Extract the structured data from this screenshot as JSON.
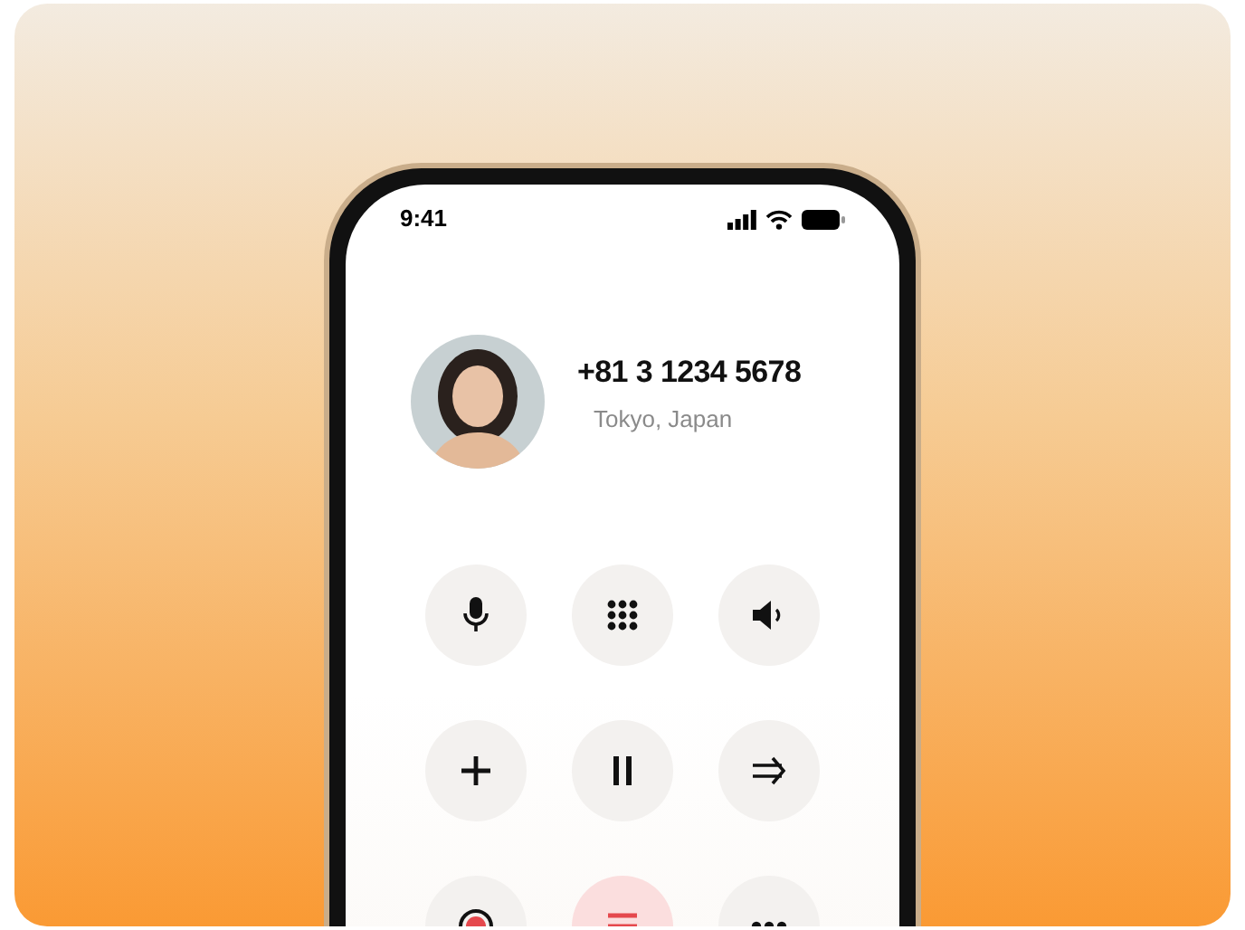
{
  "status_bar": {
    "time": "9:41"
  },
  "contact": {
    "number": "+81 3 1234 5678",
    "location": "Tokyo, Japan"
  },
  "buttons": [
    {
      "kind": "mic",
      "danger": false
    },
    {
      "kind": "keypad",
      "danger": false
    },
    {
      "kind": "speaker",
      "danger": false
    },
    {
      "kind": "add",
      "danger": false
    },
    {
      "kind": "hold",
      "danger": false
    },
    {
      "kind": "transfer",
      "danger": false
    },
    {
      "kind": "record",
      "danger": false
    },
    {
      "kind": "end",
      "danger": true
    },
    {
      "kind": "more",
      "danger": false
    }
  ]
}
